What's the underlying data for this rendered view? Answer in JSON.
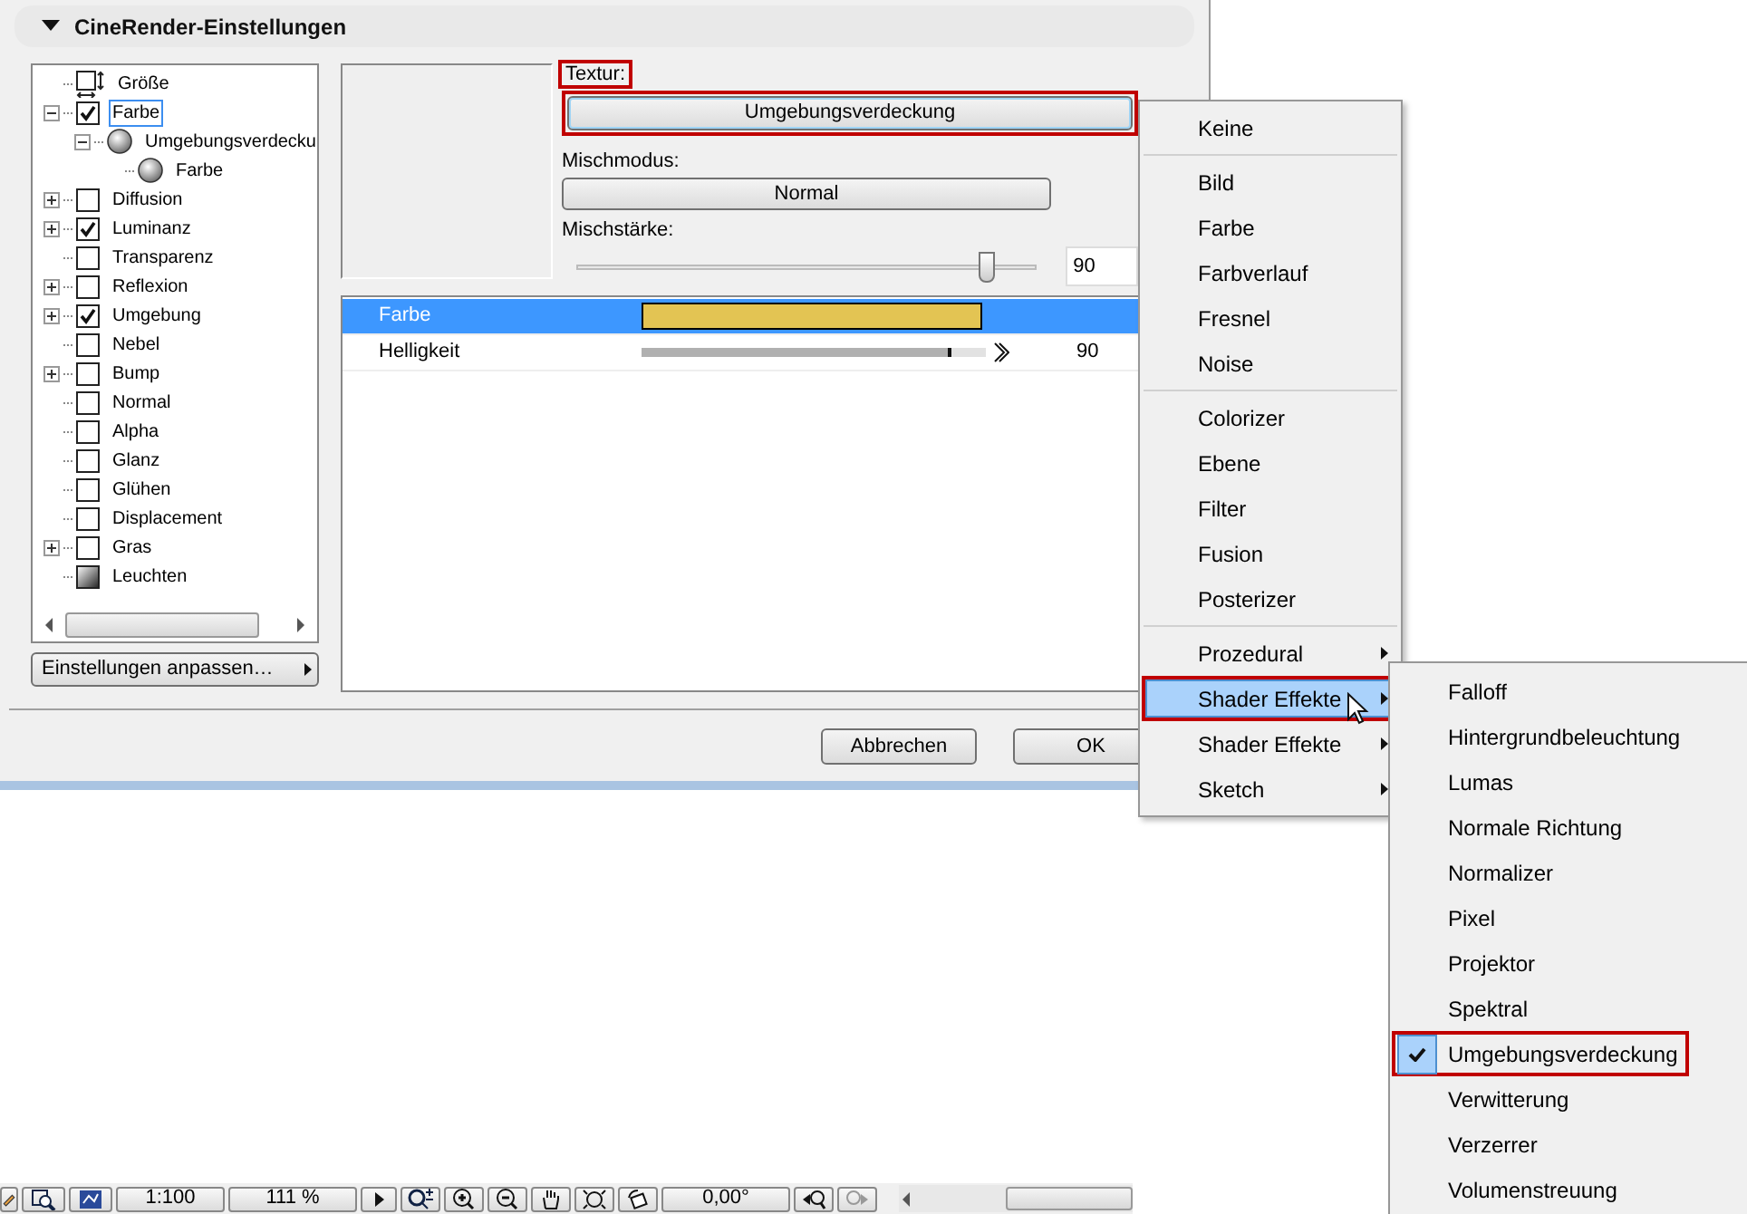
{
  "section": {
    "title": "CineRender-Einstellungen",
    "expanded": true
  },
  "tree": [
    {
      "label": "Größe",
      "kind": "size",
      "checked": false,
      "selected": false
    },
    {
      "label": "Farbe",
      "kind": "checkbox",
      "checked": true,
      "expanded": true,
      "selected": true,
      "children": [
        {
          "label": "Umgebungsverdecku",
          "kind": "sphere",
          "expanded": true,
          "selected": false,
          "children": [
            {
              "label": "Farbe",
              "kind": "sphere",
              "selected": false
            }
          ]
        }
      ]
    },
    {
      "label": "Diffusion",
      "kind": "checkbox",
      "checked": false,
      "expanded": false,
      "selected": false
    },
    {
      "label": "Luminanz",
      "kind": "checkbox",
      "checked": true,
      "expanded": false,
      "selected": false
    },
    {
      "label": "Transparenz",
      "kind": "checkbox",
      "checked": false,
      "selected": false
    },
    {
      "label": "Reflexion",
      "kind": "checkbox",
      "checked": false,
      "expanded": false,
      "selected": false
    },
    {
      "label": "Umgebung",
      "kind": "checkbox",
      "checked": true,
      "expanded": false,
      "selected": false
    },
    {
      "label": "Nebel",
      "kind": "checkbox",
      "checked": false,
      "selected": false
    },
    {
      "label": "Bump",
      "kind": "checkbox",
      "checked": false,
      "expanded": false,
      "selected": false
    },
    {
      "label": "Normal",
      "kind": "checkbox",
      "checked": false,
      "selected": false
    },
    {
      "label": "Alpha",
      "kind": "checkbox",
      "checked": false,
      "selected": false
    },
    {
      "label": "Glanz",
      "kind": "checkbox",
      "checked": false,
      "selected": false
    },
    {
      "label": "Glühen",
      "kind": "checkbox",
      "checked": false,
      "selected": false
    },
    {
      "label": "Displacement",
      "kind": "checkbox",
      "checked": false,
      "selected": false
    },
    {
      "label": "Gras",
      "kind": "checkbox",
      "checked": false,
      "expanded": false,
      "selected": false
    },
    {
      "label": "Leuchten",
      "kind": "gradient",
      "checked": false,
      "selected": false
    }
  ],
  "customize_button": "Einstellungen anpassen…",
  "texture": {
    "label": "Textur:",
    "value": "Umgebungsverdeckung",
    "annotated": true
  },
  "blend_mode": {
    "label": "Mischmodus:",
    "value": "Normal"
  },
  "blend_strength": {
    "label": "Mischstärke:",
    "level": 0.89,
    "value": "90"
  },
  "params": [
    {
      "kind": "color",
      "name": "Farbe",
      "color": "#e3c453",
      "selected": true
    },
    {
      "kind": "slider",
      "name": "Helligkeit",
      "level": 0.9,
      "reading": "90",
      "selected": false
    }
  ],
  "buttons": {
    "cancel": "Abbrechen",
    "ok": "OK"
  },
  "menu": [
    {
      "kind": "item",
      "label": "Keine",
      "selected": false,
      "annotated": false
    },
    {
      "kind": "separator"
    },
    {
      "kind": "item",
      "label": "Bild",
      "selected": false,
      "annotated": false
    },
    {
      "kind": "item",
      "label": "Farbe",
      "selected": false,
      "annotated": false
    },
    {
      "kind": "item",
      "label": "Farbverlauf",
      "selected": false,
      "annotated": false
    },
    {
      "kind": "item",
      "label": "Fresnel",
      "selected": false,
      "annotated": false
    },
    {
      "kind": "item",
      "label": "Noise",
      "selected": false,
      "annotated": false
    },
    {
      "kind": "separator"
    },
    {
      "kind": "item",
      "label": "Colorizer",
      "selected": false,
      "annotated": false
    },
    {
      "kind": "item",
      "label": "Ebene",
      "selected": false,
      "annotated": false
    },
    {
      "kind": "item",
      "label": "Filter",
      "selected": false,
      "annotated": false
    },
    {
      "kind": "item",
      "label": "Fusion",
      "selected": false,
      "annotated": false
    },
    {
      "kind": "item",
      "label": "Posterizer",
      "selected": false,
      "annotated": false
    },
    {
      "kind": "separator"
    },
    {
      "kind": "submenu",
      "label": "Prozedural",
      "selected": false,
      "annotated": false
    },
    {
      "kind": "submenu",
      "label": "Shader Effekte",
      "selected": true,
      "annotated": true
    },
    {
      "kind": "submenu",
      "label": "Shader Effekte",
      "selected": false,
      "annotated": false
    },
    {
      "kind": "submenu",
      "label": "Sketch",
      "selected": false,
      "annotated": false
    }
  ],
  "submenu": [
    {
      "label": "Falloff",
      "checked": false,
      "annotated": false
    },
    {
      "label": "Hintergrundbeleuchtung",
      "checked": false,
      "annotated": false
    },
    {
      "label": "Lumas",
      "checked": false,
      "annotated": false
    },
    {
      "label": "Normale Richtung",
      "checked": false,
      "annotated": false
    },
    {
      "label": "Normalizer",
      "checked": false,
      "annotated": false
    },
    {
      "label": "Pixel",
      "checked": false,
      "annotated": false
    },
    {
      "label": "Projektor",
      "checked": false,
      "annotated": false
    },
    {
      "label": "Spektral",
      "checked": false,
      "annotated": false
    },
    {
      "label": "Umgebungsverdeckung",
      "checked": true,
      "annotated": true
    },
    {
      "label": "Verwitterung",
      "checked": false,
      "annotated": false
    },
    {
      "label": "Verzerrer",
      "checked": false,
      "annotated": false
    },
    {
      "label": "Volumenstreuung",
      "checked": false,
      "annotated": false
    }
  ],
  "toolbar": {
    "scale": "1:100",
    "zoom": "111 %",
    "angle": "0,00°"
  }
}
